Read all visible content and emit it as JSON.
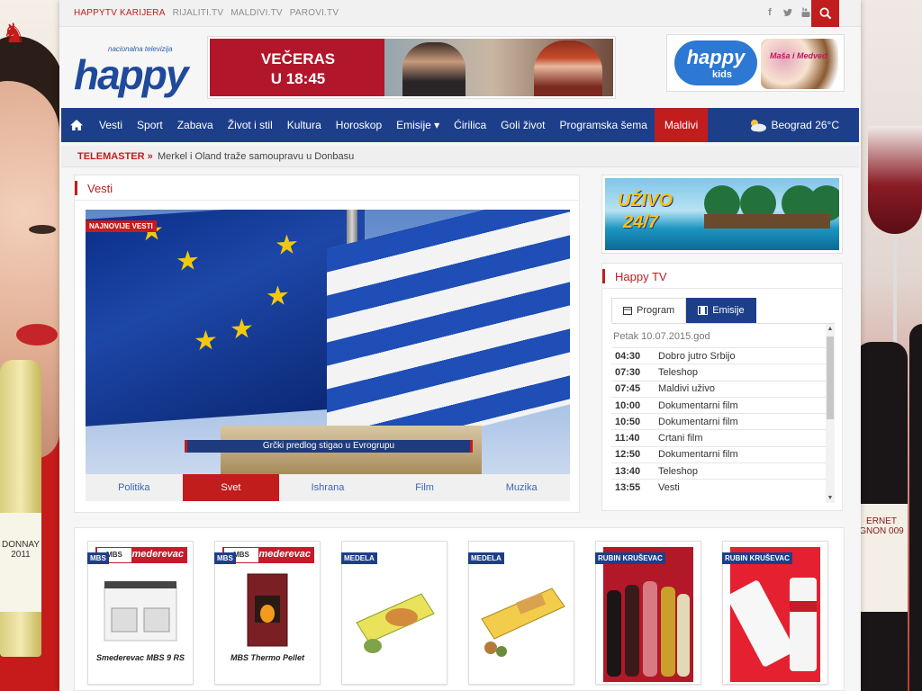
{
  "toplinks": [
    "HAPPYTV KARIJERA",
    "RIJALITI.TV",
    "MALDIVI.TV",
    "PAROVI.TV"
  ],
  "social": [
    "facebook-icon",
    "twitter-icon",
    "youtube-icon"
  ],
  "logo": {
    "tagline": "nacionalna televizija",
    "word": "happy"
  },
  "banner": {
    "line1": "VEČERAS",
    "line2": "U 18:45"
  },
  "kids": {
    "word": "happy",
    "sub": "kids",
    "masha": "Maša i Medved"
  },
  "nav": {
    "items": [
      "Vesti",
      "Sport",
      "Zabava",
      "Život i stil",
      "Kultura",
      "Horoskop",
      "Emisije ▾",
      "Ćirilica",
      "Goli život",
      "Programska šema",
      "Maldivi"
    ],
    "weather": "Beograd 26°C"
  },
  "ticker": {
    "label": "TELEMASTER »",
    "text": "Merkel i Oland traže samoupravu u Donbasu"
  },
  "news": {
    "title": "Vesti",
    "badge": "NAJNOVIJE VESTI",
    "caption": "Grčki predlog stigao u Evrogrupu",
    "categories": [
      "Politika",
      "Svet",
      "Ishrana",
      "Film",
      "Muzika"
    ],
    "active_category": "Svet"
  },
  "live_ad": {
    "line1": "UŽIVO",
    "line2": "24/7"
  },
  "tv": {
    "title": "Happy TV",
    "tabs": [
      "Program",
      "Emisije"
    ],
    "date": "Petak 10.07.2015.god",
    "schedule": [
      {
        "time": "04:30",
        "show": "Dobro jutro Srbijo"
      },
      {
        "time": "07:30",
        "show": "Teleshop"
      },
      {
        "time": "07:45",
        "show": "Maldivi uživo"
      },
      {
        "time": "10:00",
        "show": "Dokumentarni film"
      },
      {
        "time": "10:50",
        "show": "Dokumentarni film"
      },
      {
        "time": "11:40",
        "show": "Crtani film"
      },
      {
        "time": "12:50",
        "show": "Dokumentarni film"
      },
      {
        "time": "13:40",
        "show": "Teleshop"
      },
      {
        "time": "13:55",
        "show": "Vesti"
      }
    ]
  },
  "products": [
    {
      "tag": "MBS",
      "caption": "Smederevac MBS 9 RS",
      "brand": "Smederevac"
    },
    {
      "tag": "MBS",
      "caption": "MBS Thermo Pellet",
      "brand": "Smederevac"
    },
    {
      "tag": "MEDELA",
      "caption": "",
      "brand": ""
    },
    {
      "tag": "MEDELA",
      "caption": "",
      "brand": ""
    },
    {
      "tag": "RUBIN KRUŠEVAC",
      "caption": "",
      "brand": ""
    },
    {
      "tag": "RUBIN KRUŠEVAC",
      "caption": "",
      "brand": ""
    }
  ],
  "side_ads": {
    "left_text": "DONNAY 2011",
    "right_text": "ERNET GNON 009"
  },
  "colors": {
    "brand_red": "#c21d1d",
    "nav_blue": "#1d3f8a"
  }
}
